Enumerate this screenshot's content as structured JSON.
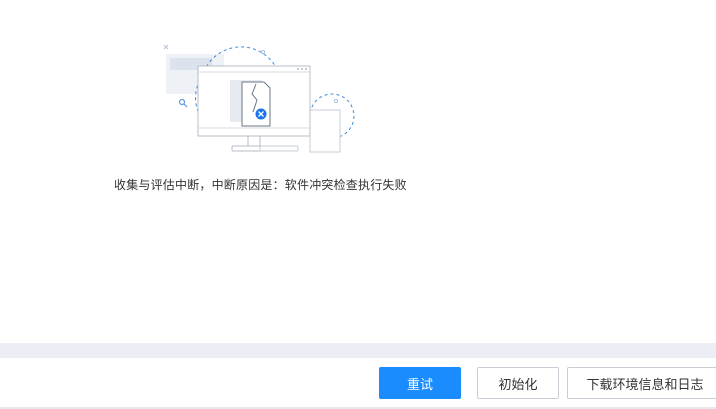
{
  "status": {
    "message": "收集与评估中断，中断原因是：软件冲突检查执行失败"
  },
  "actions": {
    "retry_label": "重试",
    "init_label": "初始化",
    "download_label": "下载环境信息和日志"
  },
  "colors": {
    "primary": "#1a8cfe",
    "illustration_dashed": "#3d8bdf",
    "band": "#ebeff5",
    "error_icon": "#1a73e8"
  },
  "icons": {
    "illustration": "broken-file-monitor-icon",
    "error_badge": "close-circle-icon"
  }
}
